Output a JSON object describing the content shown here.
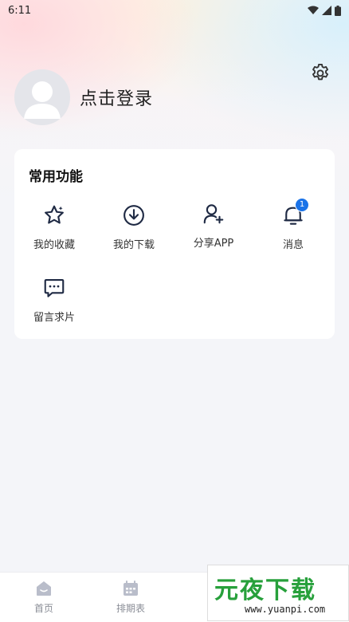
{
  "status_bar": {
    "time": "6:11"
  },
  "profile": {
    "login_text": "点击登录"
  },
  "common_functions": {
    "title": "常用功能",
    "items": [
      {
        "label": "我的收藏",
        "icon": "star-icon"
      },
      {
        "label": "我的下载",
        "icon": "download-icon"
      },
      {
        "label": "分享APP",
        "icon": "add-user-icon"
      },
      {
        "label": "消息",
        "icon": "bell-icon",
        "badge": "1"
      },
      {
        "label": "留言求片",
        "icon": "message-icon"
      }
    ]
  },
  "tabbar": {
    "items": [
      {
        "label": "首页",
        "icon": "home-icon"
      },
      {
        "label": "排期表",
        "icon": "calendar-icon"
      }
    ]
  },
  "watermark": {
    "main": "元夜下载",
    "sub": "www.yuanpi.com"
  },
  "colors": {
    "accent": "#1a73e8",
    "watermark_green": "#27a03b"
  }
}
